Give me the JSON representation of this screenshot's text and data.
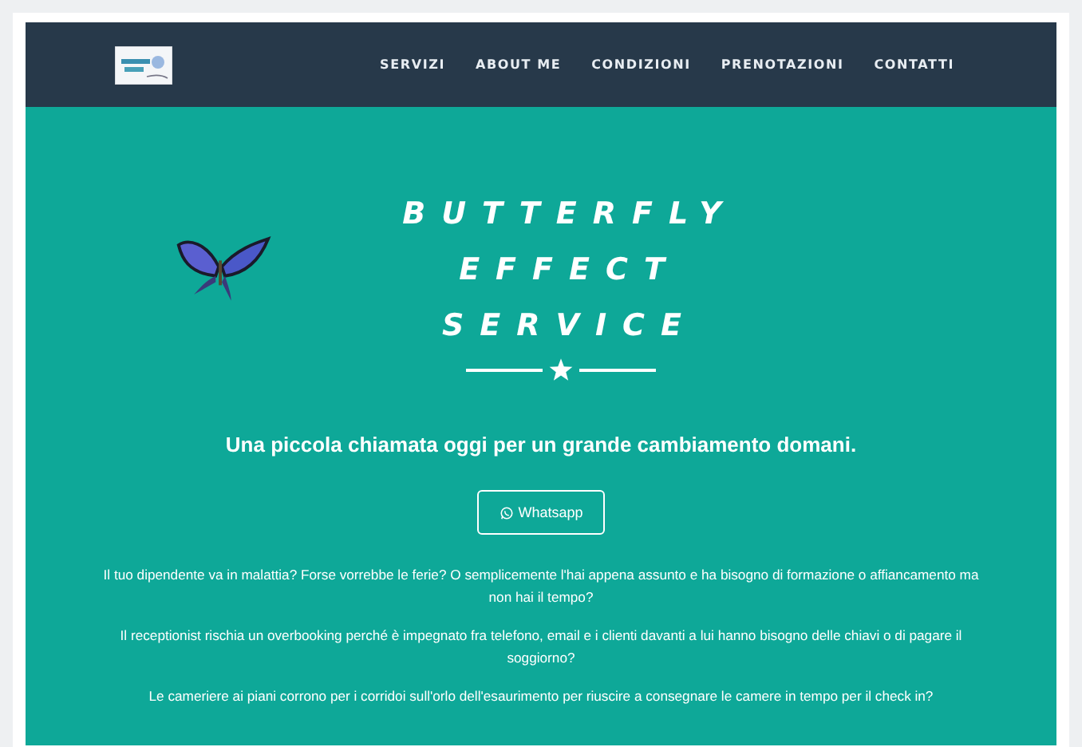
{
  "navbar": {
    "items": [
      {
        "label": "SERVIZI"
      },
      {
        "label": "ABOUT ME"
      },
      {
        "label": "CONDIZIONI"
      },
      {
        "label": "PRENOTAZIONI"
      },
      {
        "label": "CONTATTI"
      }
    ]
  },
  "hero": {
    "title_lines": [
      "BUTTERFLY",
      "EFFECT",
      "SERVICE"
    ],
    "tagline": "Una piccola chiamata oggi per un grande cambiamento domani.",
    "button": {
      "label": "Whatsapp"
    },
    "paragraphs": [
      "Il tuo dipendente va in malattia? Forse vorrebbe le ferie? O semplicemente l'hai appena assunto e ha bisogno di formazione o affiancamento ma non hai il tempo?",
      "Il receptionist rischia un overbooking perché è impegnato fra telefono, email e i clienti davanti a lui hanno bisogno delle chiavi o di pagare il soggiorno?",
      "Le cameriere ai piani corrono per i corridoi sull'orlo dell'esaurimento per riuscire a consegnare le camere in tempo per il check in?"
    ]
  }
}
